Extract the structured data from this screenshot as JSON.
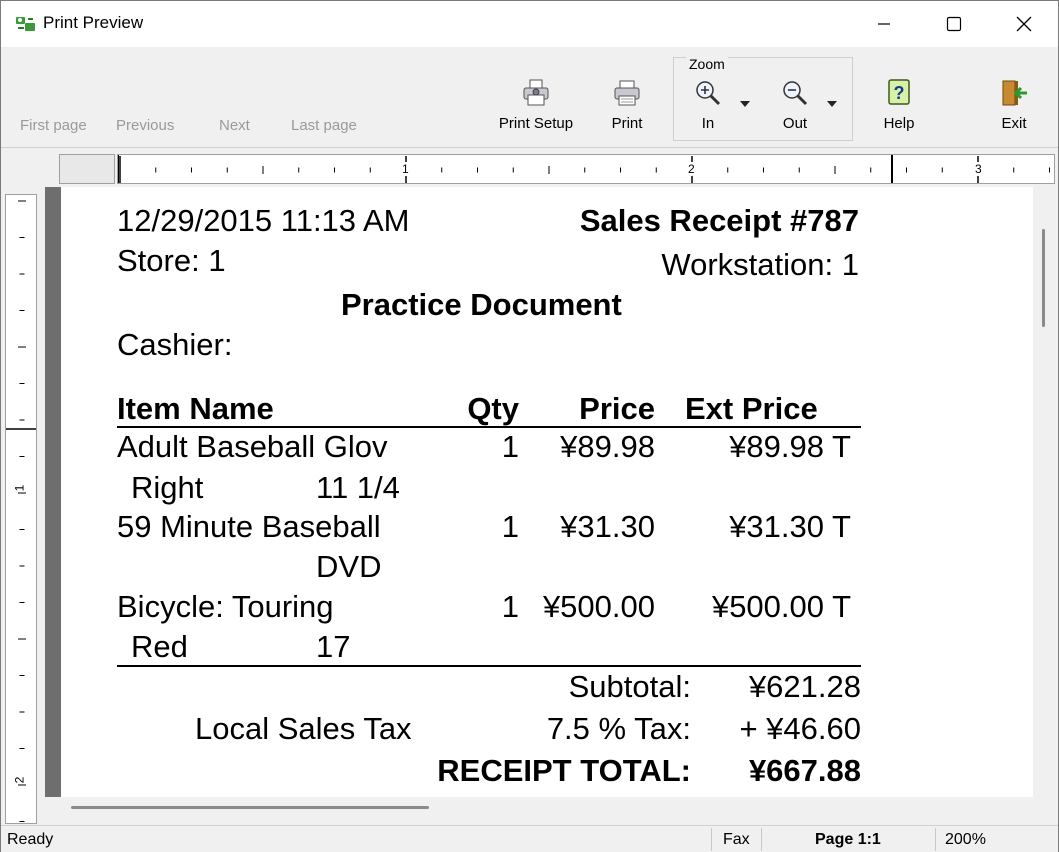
{
  "window": {
    "title": "Print Preview"
  },
  "toolbar": {
    "first_page": "First page",
    "previous": "Previous",
    "next": "Next",
    "last_page": "Last page",
    "print_setup": "Print Setup",
    "print": "Print",
    "zoom_group": "Zoom",
    "zoom_in": "In",
    "zoom_out": "Out",
    "help": "Help",
    "exit": "Exit"
  },
  "ruler": {
    "h_marks": [
      "1",
      "2",
      "3"
    ],
    "v_marks": [
      "1",
      "2"
    ]
  },
  "receipt": {
    "datetime": "12/29/2015 11:13 AM",
    "title": "Sales Receipt  #787",
    "store": "Store:  1",
    "workstation": "Workstation:  1",
    "doc_type": "Practice Document",
    "cashier": "Cashier:",
    "columns": {
      "item": "Item Name",
      "qty": "Qty",
      "price": "Price",
      "ext": "Ext Price"
    },
    "items": [
      {
        "name": "Adult Baseball Glov",
        "attr1": "Right",
        "attr2": "11 1/4",
        "qty": "1",
        "price": "¥89.98",
        "ext": "¥89.98 T"
      },
      {
        "name": "59 Minute Baseball",
        "attr1": "",
        "attr2": "DVD",
        "qty": "1",
        "price": "¥31.30",
        "ext": "¥31.30 T"
      },
      {
        "name": "Bicycle: Touring",
        "attr1": "Red",
        "attr2": "17",
        "qty": "1",
        "price": "¥500.00",
        "ext": "¥500.00 T"
      }
    ],
    "subtotal_label": "Subtotal:",
    "subtotal": "¥621.28",
    "tax_name": "Local Sales Tax",
    "tax_label": "7.5 % Tax:",
    "tax": "+ ¥46.60",
    "total_label": "RECEIPT TOTAL:",
    "total": "¥667.88"
  },
  "status": {
    "state": "Ready",
    "fax": "Fax",
    "page": "Page 1:1",
    "zoom": "200%"
  }
}
